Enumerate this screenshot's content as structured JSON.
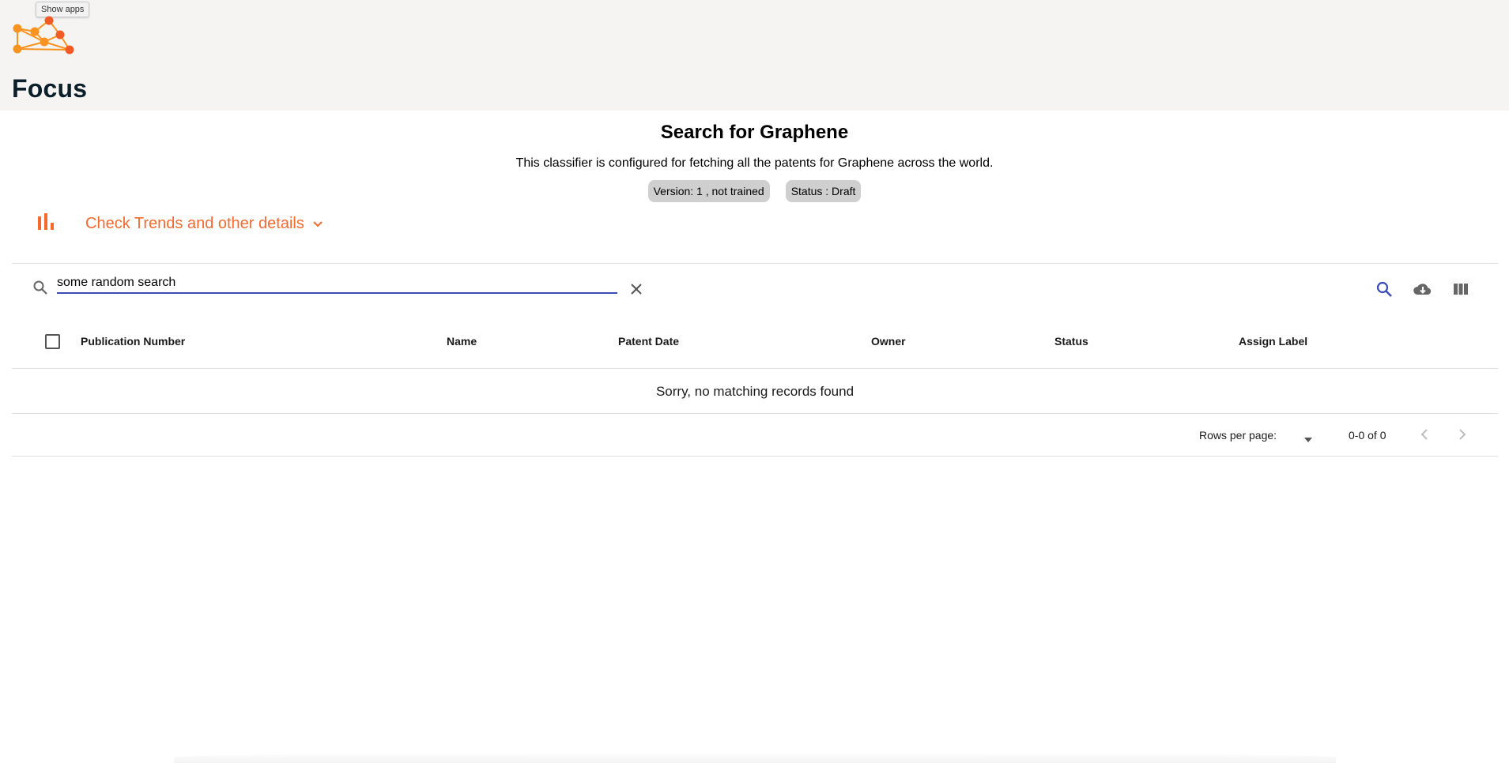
{
  "header": {
    "tooltip": "Show apps",
    "app_title": "Focus",
    "logo_icon": "network-logo-icon",
    "accent_color": "#f26a2e"
  },
  "classifier": {
    "title": "Search for Graphene",
    "description": "This classifier is configured for fetching all the patents for Graphene across the world.",
    "version_chip": "Version: 1 , not trained",
    "status_chip": "Status : Draft"
  },
  "trends": {
    "label": "Check Trends and other details",
    "icon": "bar-chart-icon",
    "expand_icon": "chevron-down-icon"
  },
  "toolbar": {
    "search_value": "some random search",
    "search_icon": "search-icon",
    "clear_icon": "close-icon",
    "download_icon": "cloud-download-icon",
    "columns_icon": "view-columns-icon"
  },
  "table": {
    "columns": [
      "Publication Number",
      "Name",
      "Patent Date",
      "Owner",
      "Status",
      "Assign Label"
    ],
    "empty_message": "Sorry, no matching records found"
  },
  "pagination": {
    "rows_per_page_label": "Rows per page:",
    "rows_per_page_value": "",
    "range": "0-0 of 0"
  }
}
